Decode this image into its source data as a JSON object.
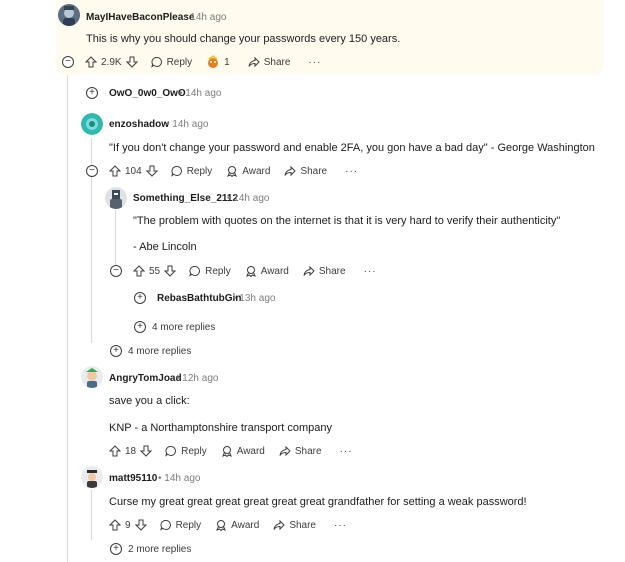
{
  "comments": {
    "c1": {
      "user": "MayIHaveBaconPlease",
      "time": "14h ago",
      "text": "This is why you should change your passwords every 150 years.",
      "score": "2.9K",
      "reply": "Reply",
      "award_count": "1",
      "share": "Share"
    },
    "c2": {
      "user": "OwO_0w0_OwO",
      "time": "14h ago"
    },
    "c3": {
      "user": "enzoshadow",
      "time": "14h ago",
      "text": "\"If you don't change your password and enable 2FA, you gon have a bad day\" - George Washington",
      "score": "104",
      "reply": "Reply",
      "award": "Award",
      "share": "Share"
    },
    "c4": {
      "user": "Something_Else_2112",
      "time": "14h ago",
      "text1": "\"The problem with quotes on the internet is that it is very hard to verify their authenticity\"",
      "text2": "- Abe Lincoln",
      "score": "55",
      "reply": "Reply",
      "award": "Award",
      "share": "Share"
    },
    "c5": {
      "user": "RebasBathtubGin",
      "time": "13h ago"
    },
    "c6": {
      "user": "AngryTomJoad",
      "time": "12h ago",
      "text1": "save you a click:",
      "text2": "KNP - a Northamptonshire transport company",
      "score": "18",
      "reply": "Reply",
      "award": "Award",
      "share": "Share"
    },
    "c7": {
      "user": "matt95110",
      "time": "14h ago",
      "text": "Curse my great great great great great great grandfather for setting a weak password!",
      "score": "9",
      "reply": "Reply",
      "award": "Award",
      "share": "Share"
    }
  },
  "more": {
    "m1": "4 more replies",
    "m2": "4 more replies",
    "m3": "2 more replies"
  },
  "dot": "•"
}
